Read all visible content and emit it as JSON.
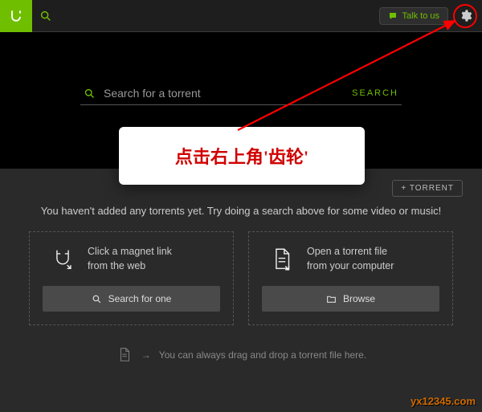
{
  "topbar": {
    "talk_label": "Talk to us"
  },
  "search": {
    "placeholder": "Search for a torrent",
    "button": "SEARCH"
  },
  "tooltip": {
    "text": "点击右上角'齿轮'"
  },
  "actions": {
    "add_torrent": "+ TORRENT"
  },
  "empty": {
    "message": "You haven't added any torrents yet. Try doing a search above for some video or music!"
  },
  "cards": [
    {
      "line1": "Click a magnet link",
      "line2": "from the web",
      "button": "Search for one"
    },
    {
      "line1": "Open a torrent file",
      "line2": "from your computer",
      "button": "Browse"
    }
  ],
  "drag_hint": "You can always drag and drop a torrent file here.",
  "watermark": "yx12345.com"
}
